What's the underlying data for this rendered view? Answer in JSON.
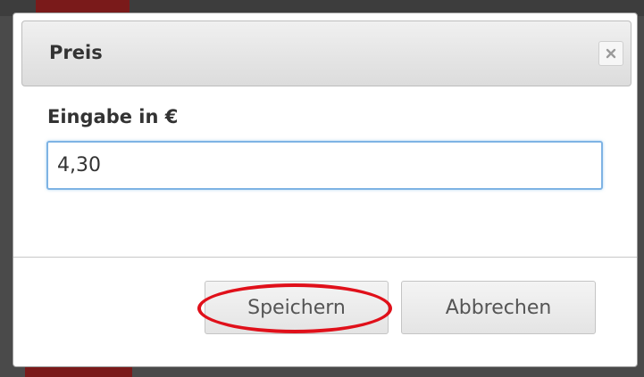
{
  "dialog": {
    "title": "Preis",
    "close_icon": "close-icon"
  },
  "form": {
    "label": "Eingabe in €",
    "value": "4,30"
  },
  "buttons": {
    "save_label": "Speichern",
    "cancel_label": "Abbrechen"
  },
  "colors": {
    "annotation": "#e0101a",
    "input_focus_border": "#7eb3e4"
  }
}
